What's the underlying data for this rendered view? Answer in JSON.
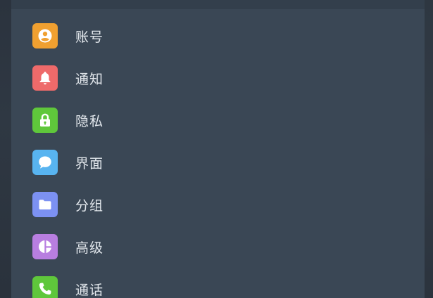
{
  "settings_menu": {
    "items": [
      {
        "label": "账号",
        "icon": "account-icon",
        "color": "#f0a030"
      },
      {
        "label": "通知",
        "icon": "bell-icon",
        "color": "#ee6a6a"
      },
      {
        "label": "隐私",
        "icon": "lock-icon",
        "color": "#5fc73b"
      },
      {
        "label": "界面",
        "icon": "chat-bubble-icon",
        "color": "#58b4f0"
      },
      {
        "label": "分组",
        "icon": "folder-icon",
        "color": "#7c91f2"
      },
      {
        "label": "高级",
        "icon": "pie-chart-icon",
        "color": "#b87ee0"
      },
      {
        "label": "通话",
        "icon": "phone-icon",
        "color": "#5fc73b"
      }
    ]
  }
}
